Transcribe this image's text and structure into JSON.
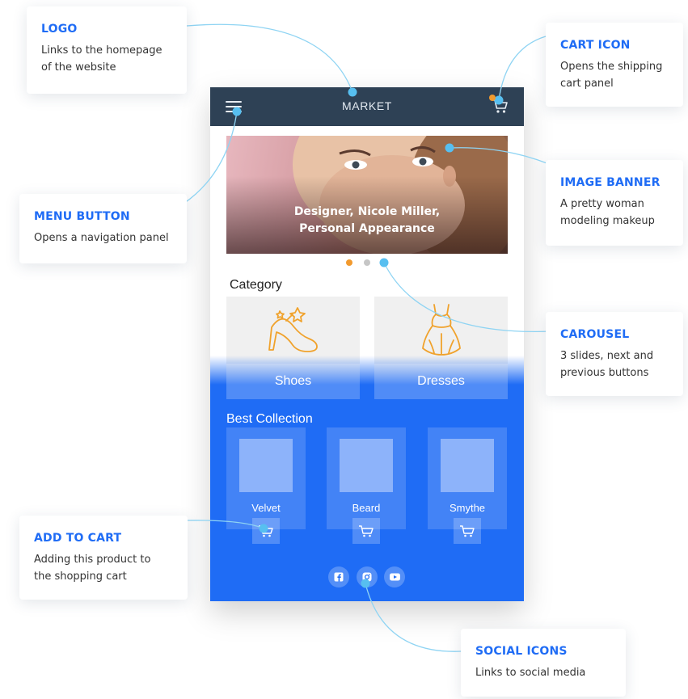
{
  "callouts": {
    "logo": {
      "title": "LOGO",
      "line1": "Links to the homepage",
      "line2": "of the website"
    },
    "menu_button": {
      "title": "MENU BUTTON",
      "line1": "Opens a navigation panel"
    },
    "add_to_cart": {
      "title": "ADD TO CART",
      "line1": "Adding this product to",
      "line2": "the shopping cart"
    },
    "cart_icon": {
      "title": "CART ICON",
      "line1": "Opens the shipping",
      "line2": "cart panel"
    },
    "image_banner": {
      "title": "IMAGE BANNER",
      "line1": "A pretty woman",
      "line2": "modeling makeup"
    },
    "carousel": {
      "title": "CAROUSEL",
      "line1": "3 slides, next and",
      "line2": "previous buttons"
    },
    "social_icons": {
      "title": "SOCIAL ICONS",
      "line1": "Links to social media"
    }
  },
  "phone": {
    "title": "MARKET",
    "banner": {
      "line1": "Designer, Nicole Miller,",
      "line2": "Personal Appearance"
    },
    "carousel": {
      "slides": 3,
      "active": 1
    },
    "category": {
      "title": "Category",
      "items": [
        {
          "label": "Shoes",
          "icon": "high-heel-shoe-icon"
        },
        {
          "label": "Dresses",
          "icon": "dress-icon"
        }
      ]
    },
    "collection": {
      "title": "Best Collection",
      "products": [
        {
          "name": "Velvet"
        },
        {
          "name": "Beard"
        },
        {
          "name": "Smythe"
        }
      ]
    },
    "social": [
      "facebook-icon",
      "instagram-icon",
      "youtube-icon"
    ]
  },
  "colors": {
    "accent_blue": "#1f6cf5",
    "topbar": "#2e4155",
    "connector": "#7fd0f2",
    "carousel_active": "#f29a2e",
    "icon_orange": "#f0a22c"
  }
}
